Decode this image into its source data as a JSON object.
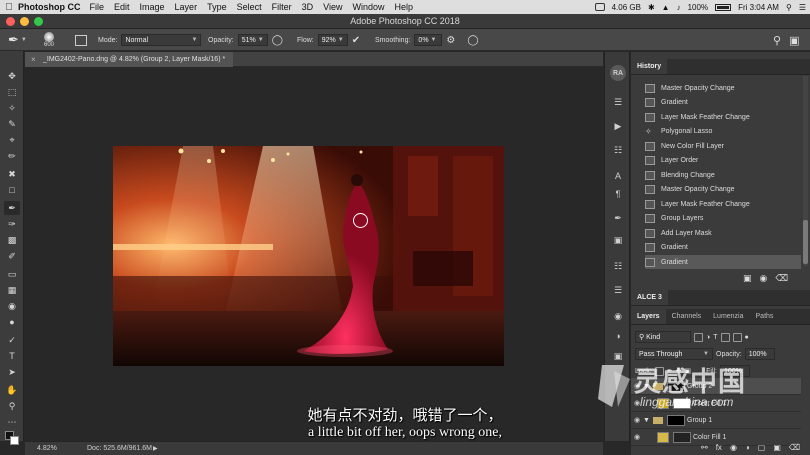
{
  "menubar": {
    "app": "Photoshop CC",
    "menus": [
      "File",
      "Edit",
      "Image",
      "Layer",
      "Type",
      "Select",
      "Filter",
      "3D",
      "View",
      "Window",
      "Help"
    ],
    "memory": "4.06 GB",
    "battery": "100%",
    "time": "Fri 3:04 AM"
  },
  "window": {
    "title": "Adobe Photoshop CC 2018"
  },
  "options": {
    "brush_size": "600",
    "mode_label": "Mode:",
    "mode_value": "Normal",
    "opacity_label": "Opacity:",
    "opacity_value": "51%",
    "flow_label": "Flow:",
    "flow_value": "92%",
    "smoothing_label": "Smoothing:",
    "smoothing_value": "0%"
  },
  "document": {
    "tab_title": "_IMG2402-Pano.dng @ 4.82% (Group 2, Layer Mask/16) *",
    "zoom": "4.82%",
    "doc_size": "Doc: 525.6M/961.6M"
  },
  "history": {
    "tab": "History",
    "items": [
      "Master Opacity Change",
      "Gradient",
      "Layer Mask Feather Change",
      "Polygonal Lasso",
      "New Color Fill Layer",
      "Layer Order",
      "Blending Change",
      "Master Opacity Change",
      "Layer Mask Feather Change",
      "Group Layers",
      "Add Layer Mask",
      "Gradient",
      "Gradient"
    ]
  },
  "alce_panel": {
    "title": "ALCE 3"
  },
  "layers": {
    "tabs": [
      "Layers",
      "Channels",
      "Lumenzia",
      "Paths"
    ],
    "kind_label": "Kind",
    "blend_mode": "Pass Through",
    "opacity_label": "Opacity:",
    "opacity_value": "100%",
    "lock_label": "Lock:",
    "fill_label": "Fill:",
    "fill_value": "100%",
    "rows": [
      {
        "name": "Group 2"
      },
      {
        "name": "Color Fill 1"
      },
      {
        "name": "Group 1"
      },
      {
        "name": "Color Fill 1"
      }
    ]
  },
  "subtitles": {
    "zh": "她有点不对劲，哦错了一个，",
    "en": "a little bit off her, oops wrong one,"
  },
  "watermark": {
    "big": "灵感中国",
    "small": "lingganchina.com"
  }
}
